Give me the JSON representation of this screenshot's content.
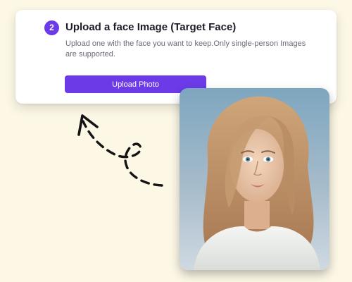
{
  "step": {
    "number": "2",
    "title": "Upload a face Image (Target Face)",
    "description": "Upload one with the face you want to keep.Only single-person Images are supported."
  },
  "upload": {
    "button_label": "Upload Photo"
  },
  "icons": {
    "arrow": "dashed-curly-arrow-icon",
    "photo": "target-face-photo"
  },
  "colors": {
    "accent": "#6d3ae8",
    "background": "#fdf8e6"
  }
}
